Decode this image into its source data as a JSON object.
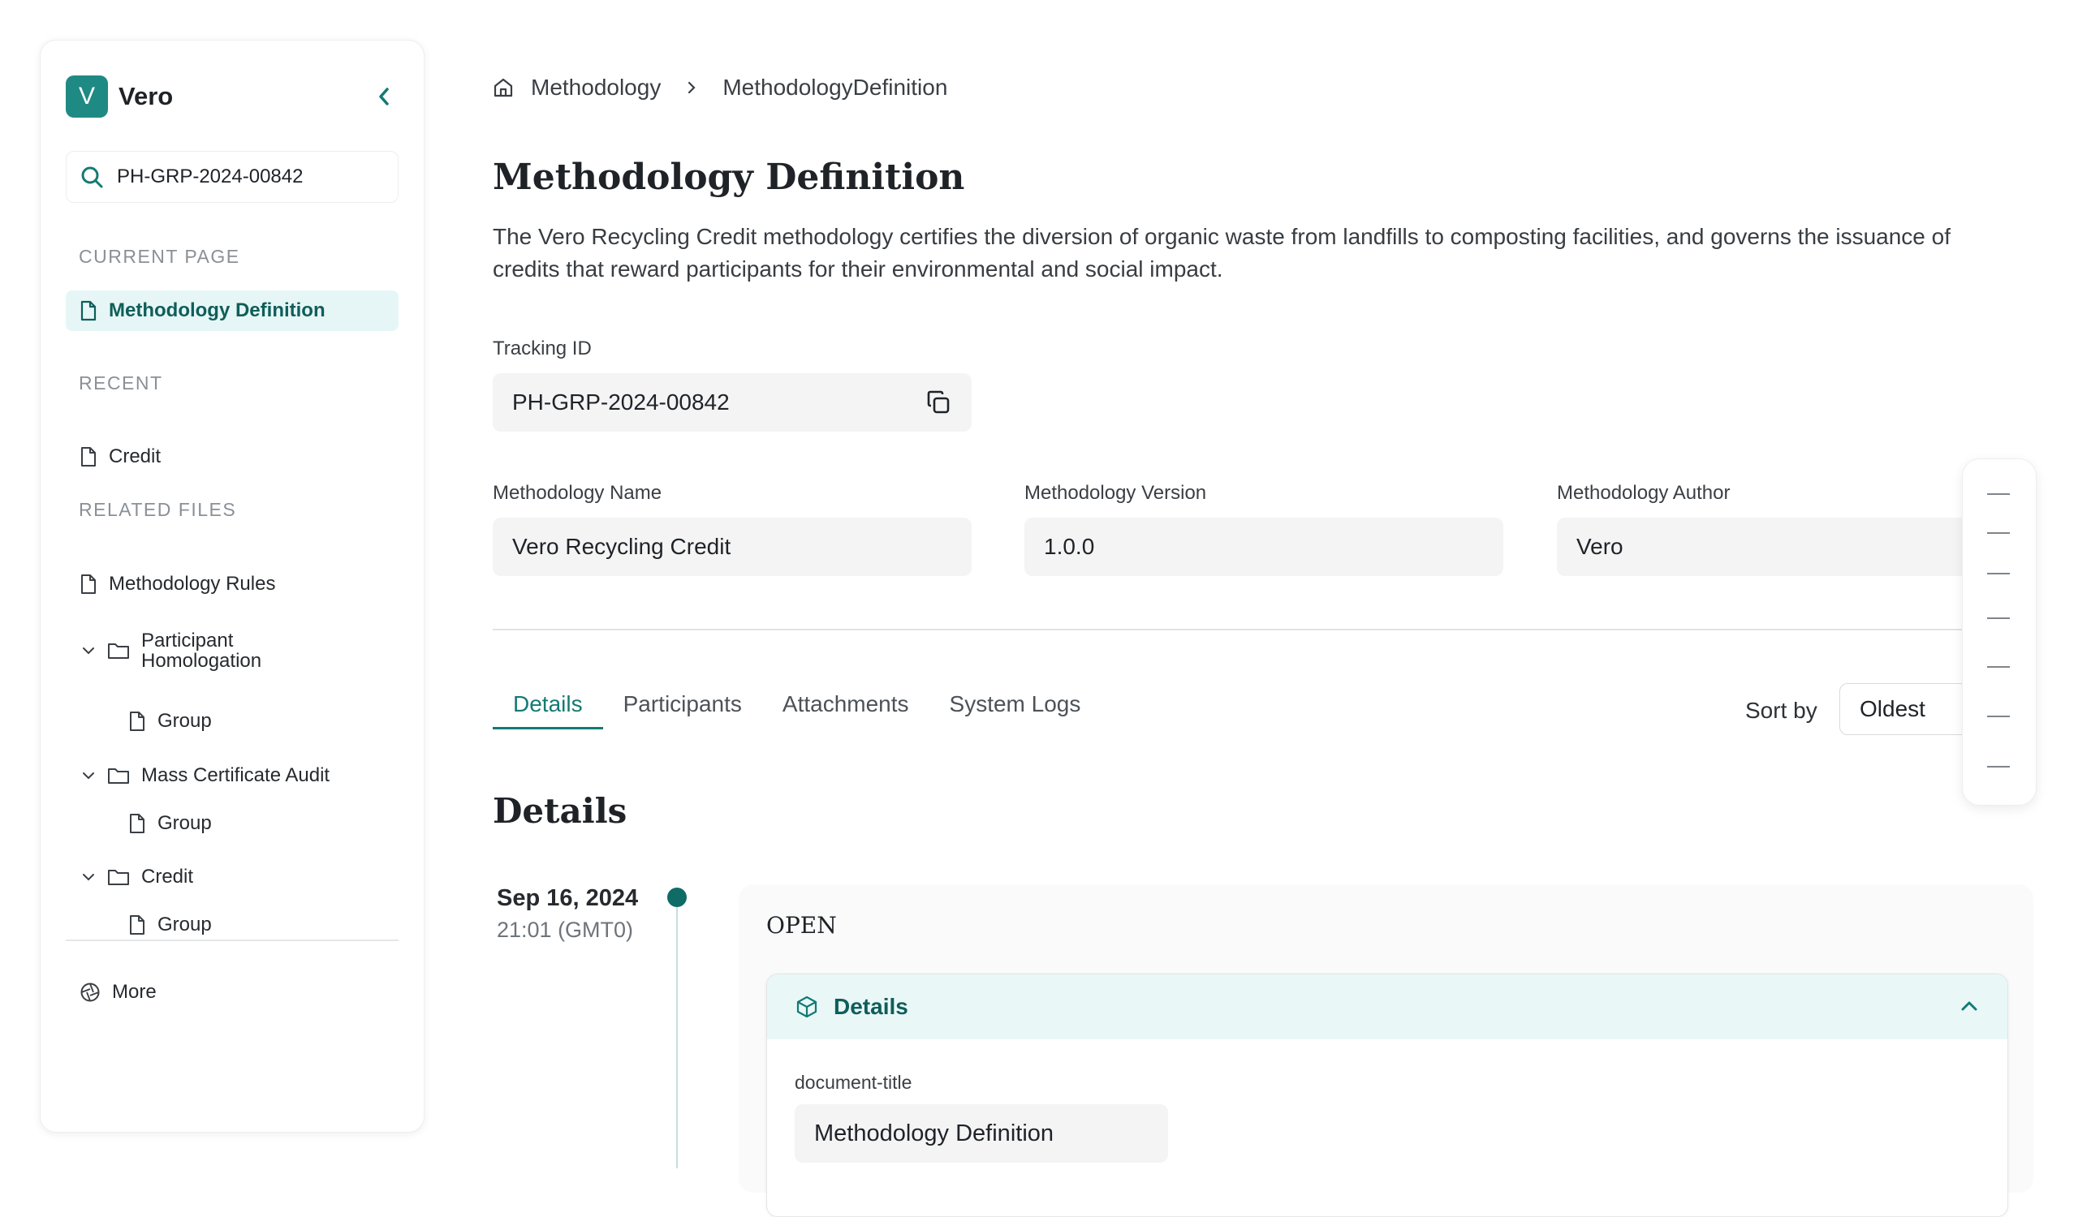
{
  "sidebar": {
    "brand_letter": "V",
    "brand_name": "Vero",
    "search_value": "PH-GRP-2024-00842",
    "current_page_title": "CURRENT PAGE",
    "current_page_item": "Methodology Definition",
    "recent_title": "RECENT",
    "recent_items": [
      "Credit"
    ],
    "related_title": "RELATED FILES",
    "related": {
      "methodology_rules": "Methodology Rules",
      "participant_homologation": "Participant Homologation",
      "participant_group": "Group",
      "mass_certificate_audit": "Mass Certificate Audit",
      "mass_group": "Group",
      "credit": "Credit",
      "credit_group": "Group"
    },
    "more": "More"
  },
  "breadcrumb": {
    "home": "Methodology",
    "current": "MethodologyDefinition"
  },
  "page": {
    "title": "Methodology Definition",
    "description": "The Vero Recycling Credit methodology certifies the diversion of organic waste from landfills to composting facilities, and governs the issuance of credits that reward participants for their environmental and social impact."
  },
  "fields": {
    "tracking_label": "Tracking ID",
    "tracking_value": "PH-GRP-2024-00842",
    "name_label": "Methodology Name",
    "name_value": "Vero Recycling Credit",
    "version_label": "Methodology Version",
    "version_value": "1.0.0",
    "author_label": "Methodology Author",
    "author_value": "Vero"
  },
  "tabs": [
    "Details",
    "Participants",
    "Attachments",
    "System Logs"
  ],
  "sort": {
    "label": "Sort by",
    "value": "Oldest"
  },
  "details": {
    "heading": "Details",
    "event_date": "Sep 16, 2024",
    "event_time": "21:01 (GMT0)",
    "status": "OPEN",
    "accordion_title": "Details",
    "doc_label": "document-title",
    "doc_value": "Methodology Definition"
  },
  "colors": {
    "accent": "#137a74",
    "accent_bg": "#e6f6f6",
    "field_bg": "#f4f4f4"
  }
}
